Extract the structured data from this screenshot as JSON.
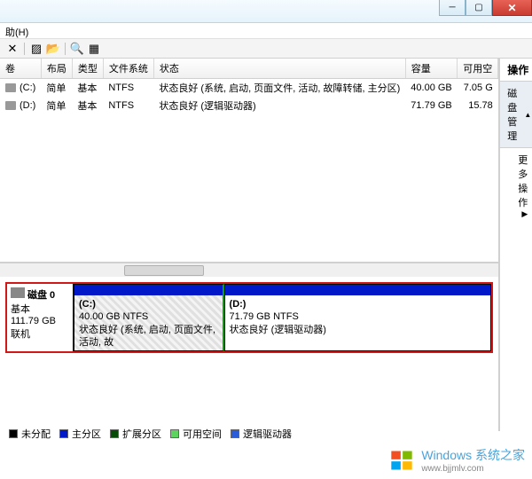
{
  "menu": {
    "help_label": "助(H)"
  },
  "toolbar": {
    "icons": [
      "x-icon",
      "props-icon",
      "folder-icon",
      "refresh-icon",
      "list-icon"
    ]
  },
  "columns": {
    "volume": "卷",
    "layout": "布局",
    "type": "类型",
    "filesystem": "文件系统",
    "status": "状态",
    "capacity": "容量",
    "freespace": "可用空"
  },
  "volumes": [
    {
      "drive": "(C:)",
      "layout": "简单",
      "type": "基本",
      "fs": "NTFS",
      "status": "状态良好 (系统, 启动, 页面文件, 活动, 故障转储, 主分区)",
      "cap": "40.00 GB",
      "free": "7.05 G"
    },
    {
      "drive": "(D:)",
      "layout": "简单",
      "type": "基本",
      "fs": "NTFS",
      "status": "状态良好 (逻辑驱动器)",
      "cap": "71.79 GB",
      "free": "15.78"
    }
  ],
  "disk": {
    "name": "磁盘 0",
    "type": "基本",
    "size": "111.79 GB",
    "state": "联机",
    "partitions": [
      {
        "label": "(C:)",
        "size_fs": "40.00 GB NTFS",
        "status": "状态良好 (系统, 启动, 页面文件, 活动, 故"
      },
      {
        "label": "(D:)",
        "size_fs": "71.79 GB NTFS",
        "status": "状态良好 (逻辑驱动器)"
      }
    ]
  },
  "legend": {
    "unallocated": "未分配",
    "primary": "主分区",
    "extended": "扩展分区",
    "free": "可用空间",
    "logical": "逻辑驱动器"
  },
  "actions": {
    "title": "操作",
    "section": "磁盘管理",
    "more": "更多操作"
  },
  "watermark": {
    "line1": "Windows 系统之家",
    "line2": "www.bjjmlv.com"
  }
}
